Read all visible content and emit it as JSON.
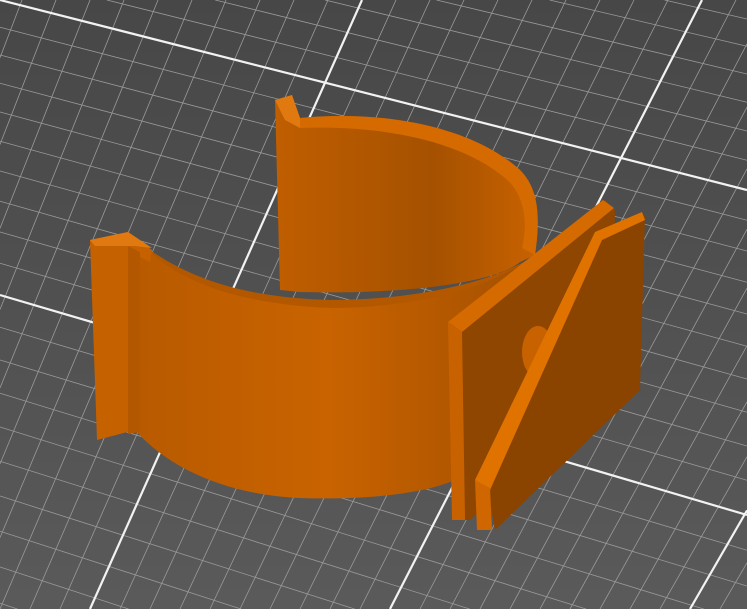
{
  "viewport": {
    "background_color": "#4f4f4f",
    "grid_minor_color": "#9a9a9a",
    "grid_major_color": "#f2f2f2"
  },
  "model": {
    "color_light": "#e07000",
    "color_mid": "#c25f00",
    "color_dark": "#8f4600"
  }
}
